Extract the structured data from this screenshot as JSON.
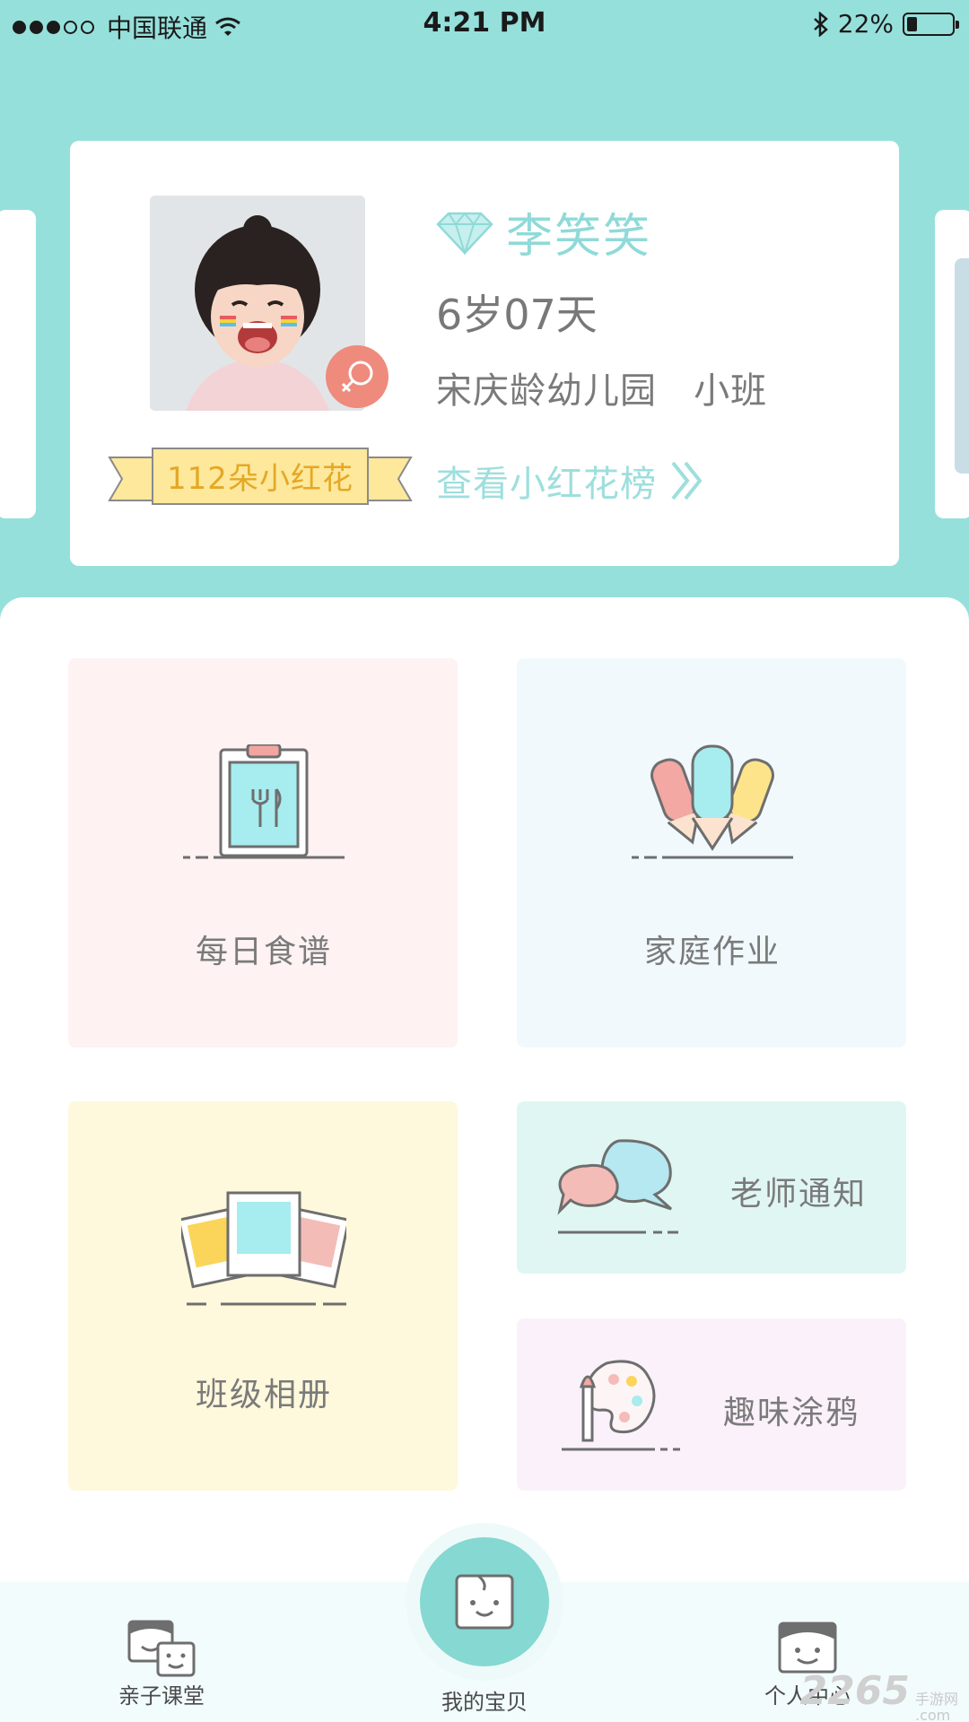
{
  "status_bar": {
    "carrier": "中国联通",
    "time": "4:21 PM",
    "battery": "22%",
    "battery_level": 0.22,
    "signal_bars_filled": 3,
    "signal_bars_total": 5
  },
  "profile": {
    "name": "李笑笑",
    "age": "6岁07天",
    "school": "宋庆龄幼儿园   小班",
    "flower_count": "112朵小红花",
    "flower_link": "查看小红花榜",
    "gender_icon": "female-icon",
    "name_icon": "diamond-icon"
  },
  "tiles": {
    "recipe": {
      "label": "每日食谱",
      "icon": "clipboard-fork-icon"
    },
    "homework": {
      "label": "家庭作业",
      "icon": "pencils-icon"
    },
    "album": {
      "label": "班级相册",
      "icon": "photos-icon"
    },
    "notice": {
      "label": "老师通知",
      "icon": "chat-bubbles-icon"
    },
    "doodle": {
      "label": "趣味涂鸦",
      "icon": "palette-icon"
    }
  },
  "nav": {
    "parent_class": "亲子课堂",
    "my_baby": "我的宝贝",
    "personal": "个人中心"
  },
  "watermark": {
    "number": "2265",
    "cn": "手游网",
    "domain": ".com"
  },
  "colors": {
    "accent": "#96e0db",
    "card": "#ffffff",
    "gender": "#ee8b7d",
    "flower_text": "#e5a825",
    "ribbon": "#fde89c"
  }
}
